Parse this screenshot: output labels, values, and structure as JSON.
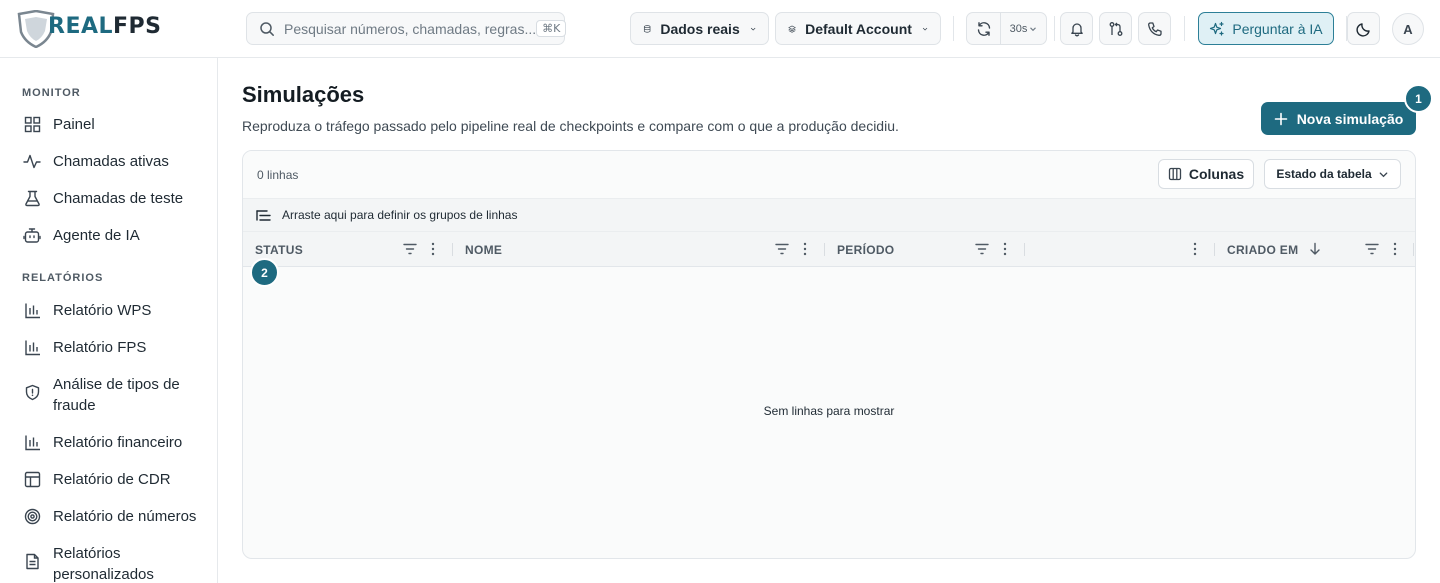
{
  "brand": {
    "name_part1": "REAL",
    "name_part2": "FPS"
  },
  "header": {
    "search_placeholder": "Pesquisar números, chamadas, regras...",
    "search_shortcut": "⌘K",
    "data_source": "Dados reais",
    "account": "Default Account",
    "refresh_interval": "30s",
    "ask_ai": "Perguntar à IA",
    "avatar_initial": "A"
  },
  "sidebar": {
    "sections": [
      {
        "title": "MONITOR",
        "items": [
          {
            "label": "Painel",
            "icon": "grid-icon"
          },
          {
            "label": "Chamadas ativas",
            "icon": "activity-icon"
          },
          {
            "label": "Chamadas de teste",
            "icon": "flask-icon"
          },
          {
            "label": "Agente de IA",
            "icon": "bot-icon"
          }
        ]
      },
      {
        "title": "RELATÓRIOS",
        "items": [
          {
            "label": "Relatório WPS",
            "icon": "bar-chart-icon"
          },
          {
            "label": "Relatório FPS",
            "icon": "bar-chart-icon"
          },
          {
            "label": "Análise de tipos de fraude",
            "icon": "shield-icon"
          },
          {
            "label": "Relatório financeiro",
            "icon": "bar-chart-icon"
          },
          {
            "label": "Relatório de CDR",
            "icon": "table-icon"
          },
          {
            "label": "Relatório de números",
            "icon": "target-icon"
          },
          {
            "label": "Relatórios personalizados",
            "icon": "file-icon"
          }
        ]
      }
    ]
  },
  "main": {
    "title": "Simulações",
    "subtitle": "Reproduza o tráfego passado pelo pipeline real de checkpoints e compare com o que a produção decidiu.",
    "new_button": "Nova simulação",
    "markers": [
      "1",
      "2"
    ],
    "grid": {
      "row_count": "0 linhas",
      "columns_button": "Colunas",
      "table_state": "Estado da tabela",
      "group_hint": "Arraste aqui para definir os grupos de linhas",
      "columns": [
        {
          "label": "STATUS"
        },
        {
          "label": "NOME"
        },
        {
          "label": "PERÍODO"
        },
        {
          "label": ""
        },
        {
          "label": "CRIADO EM",
          "sort": "desc"
        }
      ],
      "empty_message": "Sem linhas para mostrar"
    }
  },
  "colors": {
    "accent": "#1e6a80",
    "accent_light": "#dff0f5",
    "border": "#e2e6ea"
  }
}
